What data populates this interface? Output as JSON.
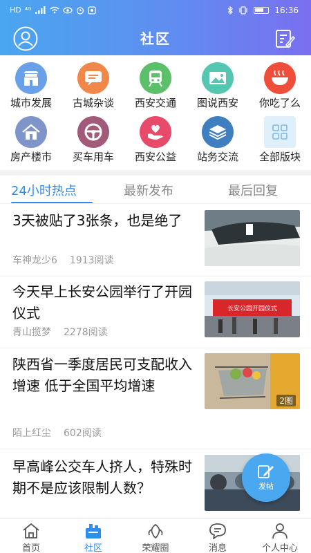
{
  "status_bar": {
    "time": "16:36",
    "network": "HD",
    "signal": "⁴ᴳ"
  },
  "header": {
    "title": "社区"
  },
  "categories": [
    {
      "label": "城市发展",
      "icon": "city-building-icon",
      "color": "#6aa0e8"
    },
    {
      "label": "古城杂谈",
      "icon": "chat-bubble-icon",
      "color": "#f2874a"
    },
    {
      "label": "西安交通",
      "icon": "train-icon",
      "color": "#5cc06a"
    },
    {
      "label": "图说西安",
      "icon": "image-icon",
      "color": "#55c6b0"
    },
    {
      "label": "你吃了么",
      "icon": "noodle-bowl-icon",
      "color": "#ef4f3a"
    },
    {
      "label": "房产楼市",
      "icon": "house-icon",
      "color": "#7f95c9"
    },
    {
      "label": "买车用车",
      "icon": "steering-wheel-icon",
      "color": "#a25a7a"
    },
    {
      "label": "西安公益",
      "icon": "heart-hand-icon",
      "color": "#e84b6a"
    },
    {
      "label": "站务交流",
      "icon": "layers-icon",
      "color": "#3f7fc0"
    },
    {
      "label": "全部版块",
      "icon": "grid-icon",
      "color": "#dff0fb"
    }
  ],
  "tabs": [
    {
      "label": "24小时热点",
      "active": true
    },
    {
      "label": "最新发布",
      "active": false
    },
    {
      "label": "最后回复",
      "active": false
    }
  ],
  "news": [
    {
      "title": "3天被贴了3张条，也是绝了",
      "author": "车神龙少6",
      "reads": "1913阅读"
    },
    {
      "title": "今天早上长安公园举行了开园仪式",
      "author": "青山揽梦",
      "reads": "2278阅读",
      "thumb_text": "长安公园开园仪式"
    },
    {
      "title": "陕西省一季度居民可支配收入增速 低于全国平均增速",
      "author": "陌上红尘",
      "reads": "602阅读",
      "badge": "2图"
    },
    {
      "title": "早高峰公交车人挤人，特殊时期不是应该限制人数？",
      "author": "",
      "reads": ""
    }
  ],
  "fab": {
    "label": "发帖"
  },
  "bottom_nav": [
    {
      "label": "首页",
      "icon": "home-icon",
      "active": false
    },
    {
      "label": "社区",
      "icon": "community-icon",
      "active": true
    },
    {
      "label": "荣耀圈",
      "icon": "honor-circle-icon",
      "active": false
    },
    {
      "label": "消息",
      "icon": "message-icon",
      "active": false
    },
    {
      "label": "个人中心",
      "icon": "user-icon",
      "active": false
    }
  ],
  "colors": {
    "accent": "#2d8ef0",
    "header_start": "#4aa6f0",
    "header_end": "#7a6ff0"
  }
}
